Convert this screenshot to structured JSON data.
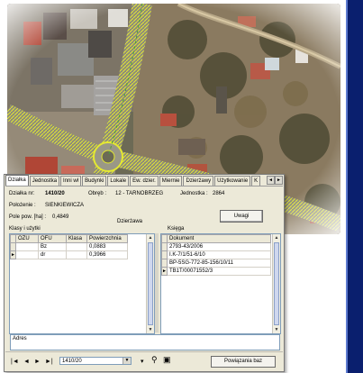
{
  "tabs": [
    "Działka",
    "Jednostka",
    "Inni wł",
    "Budynki",
    "Lokale",
    "Ew. dzier.",
    "Miernie",
    "Dzierżawy",
    "Użytkowanie",
    "K"
  ],
  "active_tab": 0,
  "tab_nav": [
    "◄",
    "►"
  ],
  "fields": {
    "dzialka_label": "Działka nr:",
    "dzialka_value": "1410/20",
    "obreb_label": "Obręb :",
    "obreb_value": "12 - TARNOBRZEG",
    "jednostka_label": "Jednostka :",
    "jednostka_value": "2864",
    "polozenie_label": "Położenie :",
    "polozenie_value": "SIENKIEWICZA",
    "pole_label": "Pole pow. [ha] :",
    "pole_value": "0,4849",
    "dzierzawa_label": "Dzierżawa"
  },
  "uwagi_label": "Uwagi",
  "klasy": {
    "title": "Klasy i użytki",
    "columns": [
      "OZU",
      "OFU",
      "Klasa",
      "Powierzchnia"
    ],
    "rows": [
      [
        "",
        "Bz",
        "",
        "0,0883"
      ],
      [
        "",
        "dr",
        "",
        "0,3966"
      ]
    ]
  },
  "ksiega": {
    "title": "Księga",
    "column": "Dokument",
    "rows": [
      "2793-43/2006",
      "I.K-7/1/51-6/10",
      "BP-5SG-772-85-156/10/11",
      "TB1T/00071552/3"
    ]
  },
  "address_label": "Adres",
  "bottom": {
    "record_value": "1410/20",
    "powiazania_label": "Powiązania baz",
    "nav_icons": [
      "first-icon",
      "prev-icon",
      "next-icon",
      "last-icon"
    ]
  },
  "colors": {
    "window_bg": "#ece9d8",
    "grid_border": "#7f9db9",
    "strip": "#0a1f6e",
    "road_highlight": "#d9e03a"
  }
}
